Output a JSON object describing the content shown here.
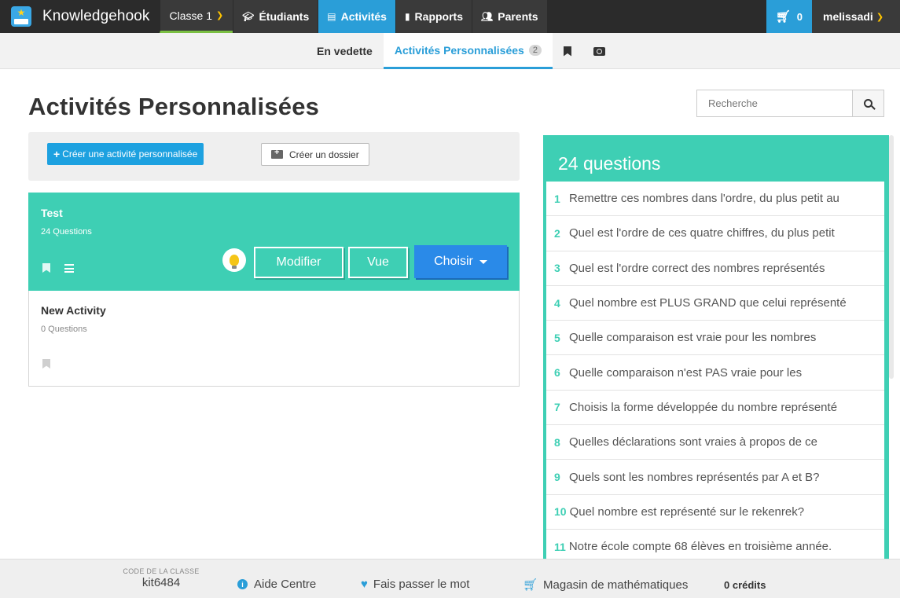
{
  "topnav": {
    "brand": "Knowledgehook",
    "class_selector": "Classe 1",
    "items": [
      {
        "label": "Étudiants",
        "icon": "graduation-cap-icon"
      },
      {
        "label": "Activités",
        "icon": "book-icon"
      },
      {
        "label": "Rapports",
        "icon": "bar-chart-icon"
      },
      {
        "label": "Parents",
        "icon": "users-icon"
      }
    ],
    "cart_count": "0",
    "username": "melissadi"
  },
  "subnav": {
    "featured": "En vedette",
    "custom": "Activités Personnalisées",
    "custom_count": "2"
  },
  "page": {
    "title": "Activités Personnalisées"
  },
  "search": {
    "placeholder": "Recherche"
  },
  "toolbar": {
    "create_label": "Créer une activité personnalisée",
    "folder_label": "Créer un dossier"
  },
  "activities": [
    {
      "title": "Test",
      "subtitle": "24 Questions",
      "edit_label": "Modifier",
      "view_label": "Vue",
      "choose_label": "Choisir"
    },
    {
      "title": "New Activity",
      "subtitle": "0 Questions"
    }
  ],
  "questions_panel": {
    "header": "24 questions",
    "items": [
      {
        "num": "1",
        "text": "Remettre ces nombres dans l'ordre, du plus petit au"
      },
      {
        "num": "2",
        "text": "Quel est l'ordre de ces quatre chiffres, du plus petit"
      },
      {
        "num": "3",
        "text": "Quel est l'ordre correct des nombres représentés"
      },
      {
        "num": "4",
        "text": "Quel nombre est PLUS GRAND que celui représenté"
      },
      {
        "num": "5",
        "text": "Quelle comparaison est vraie pour les nombres"
      },
      {
        "num": "6",
        "text": "Quelle comparaison n'est PAS vraie pour les"
      },
      {
        "num": "7",
        "text": "Choisis la forme développée du nombre représenté"
      },
      {
        "num": "8",
        "text": "Quelles déclarations sont vraies à propos de ce"
      },
      {
        "num": "9",
        "text": "Quels sont les nombres représentés par A et B?"
      },
      {
        "num": "10",
        "text": "Quel nombre est représenté sur le rekenrek?"
      },
      {
        "num": "11",
        "text": "Notre école compte 68 élèves en troisième année."
      }
    ]
  },
  "footer": {
    "code_label": "CODE DE LA CLASSE",
    "code_value": "kit6484",
    "help": "Aide Centre",
    "share": "Fais passer le mot",
    "store": "Magasin de mathématiques",
    "credits": "0 crédits"
  }
}
